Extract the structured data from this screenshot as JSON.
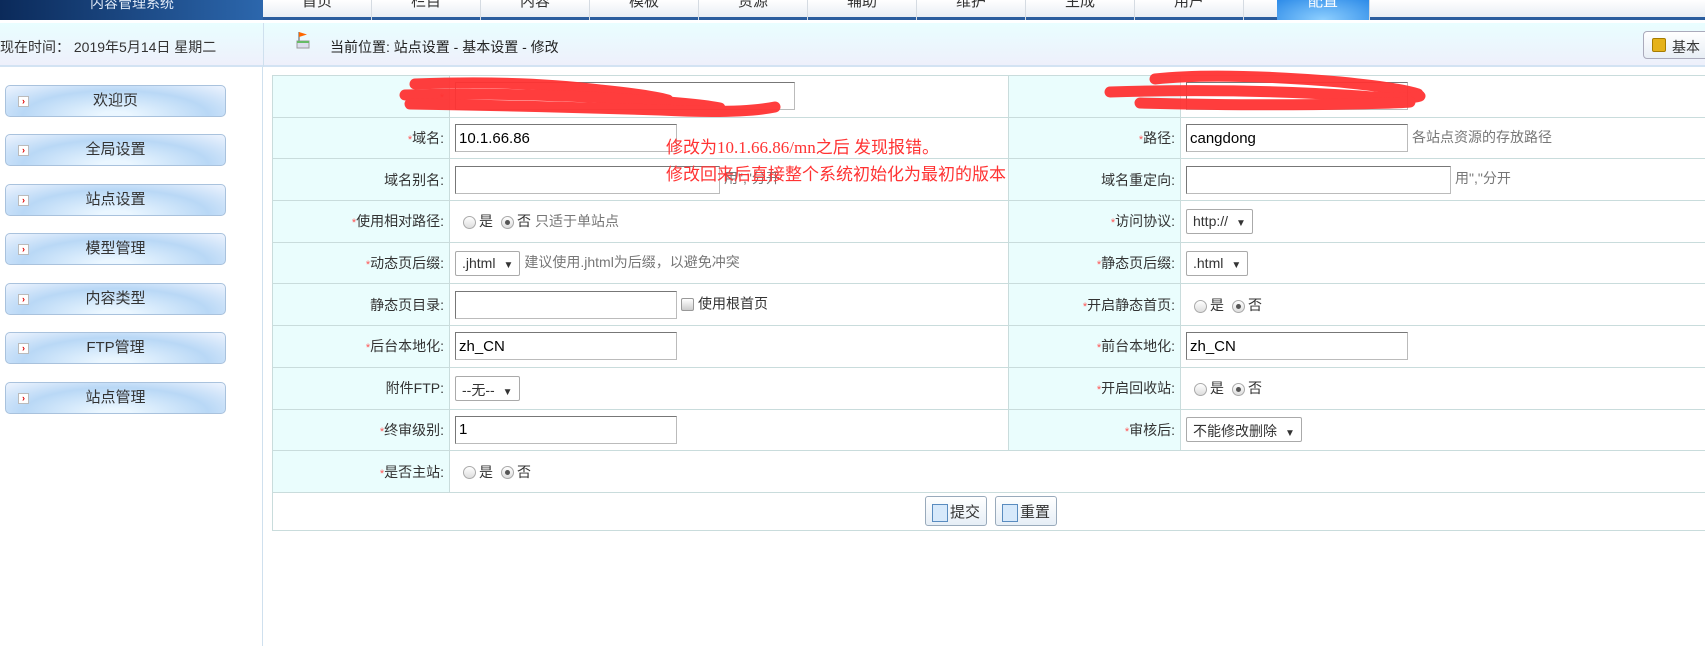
{
  "header": {
    "logo_text": "内容管理系统",
    "tabs": [
      "首页",
      "栏目",
      "内容",
      "模板",
      "资源",
      "辅助",
      "维护",
      "生成",
      "用户",
      "配置"
    ],
    "active_tab": "配置"
  },
  "infobar": {
    "datetime": "现在时间： 2019年5月14日 星期二",
    "breadcrumb": "当前位置: 站点设置 - 基本设置 - 修改",
    "basic_button": "基本"
  },
  "sidebar": {
    "items": [
      "欢迎页",
      "全局设置",
      "站点设置",
      "模型管理",
      "内容类型",
      "FTP管理",
      "站点管理"
    ]
  },
  "form": {
    "domain": {
      "label": "域名:",
      "value": "10.1.66.86"
    },
    "path": {
      "label": "路径:",
      "value": "cangdong",
      "hint": "各站点资源的存放路径"
    },
    "alias": {
      "label": "域名别名:",
      "value": "",
      "hint": "用\",\"分开"
    },
    "redirect": {
      "label": "域名重定向:",
      "value": "",
      "hint": "用\",\"分开"
    },
    "relative": {
      "label": "使用相对路径:",
      "yes": "是",
      "no": "否",
      "hint": "只适于单站点"
    },
    "protocol": {
      "label": "访问协议:",
      "value": "http://"
    },
    "dyn_suffix": {
      "label": "动态页后缀:",
      "value": ".jhtml",
      "hint": "建议使用.jhtml为后缀，以避免冲突"
    },
    "static_suffix": {
      "label": "静态页后缀:",
      "value": ".html"
    },
    "static_dir": {
      "label": "静态页目录:",
      "value": "",
      "checkbox": "使用根首页"
    },
    "static_index": {
      "label": "开启静态首页:",
      "yes": "是",
      "no": "否"
    },
    "admin_locale": {
      "label": "后台本地化:",
      "value": "zh_CN"
    },
    "front_locale": {
      "label": "前台本地化:",
      "value": "zh_CN"
    },
    "ftp": {
      "label": "附件FTP:",
      "value": "--无--"
    },
    "recycle": {
      "label": "开启回收站:",
      "yes": "是",
      "no": "否"
    },
    "final_level": {
      "label": "终审级别:",
      "value": "1"
    },
    "after_audit": {
      "label": "审核后:",
      "value": "不能修改删除"
    },
    "master": {
      "label": "是否主站:",
      "yes": "是",
      "no": "否"
    },
    "submit": "提交",
    "reset": "重置",
    "req": "*"
  },
  "annotation": {
    "line1": "修改为10.1.66.86/mn之后 发现报错。",
    "line2": "修改回来后直接整个系统初始化为最初的版本"
  }
}
